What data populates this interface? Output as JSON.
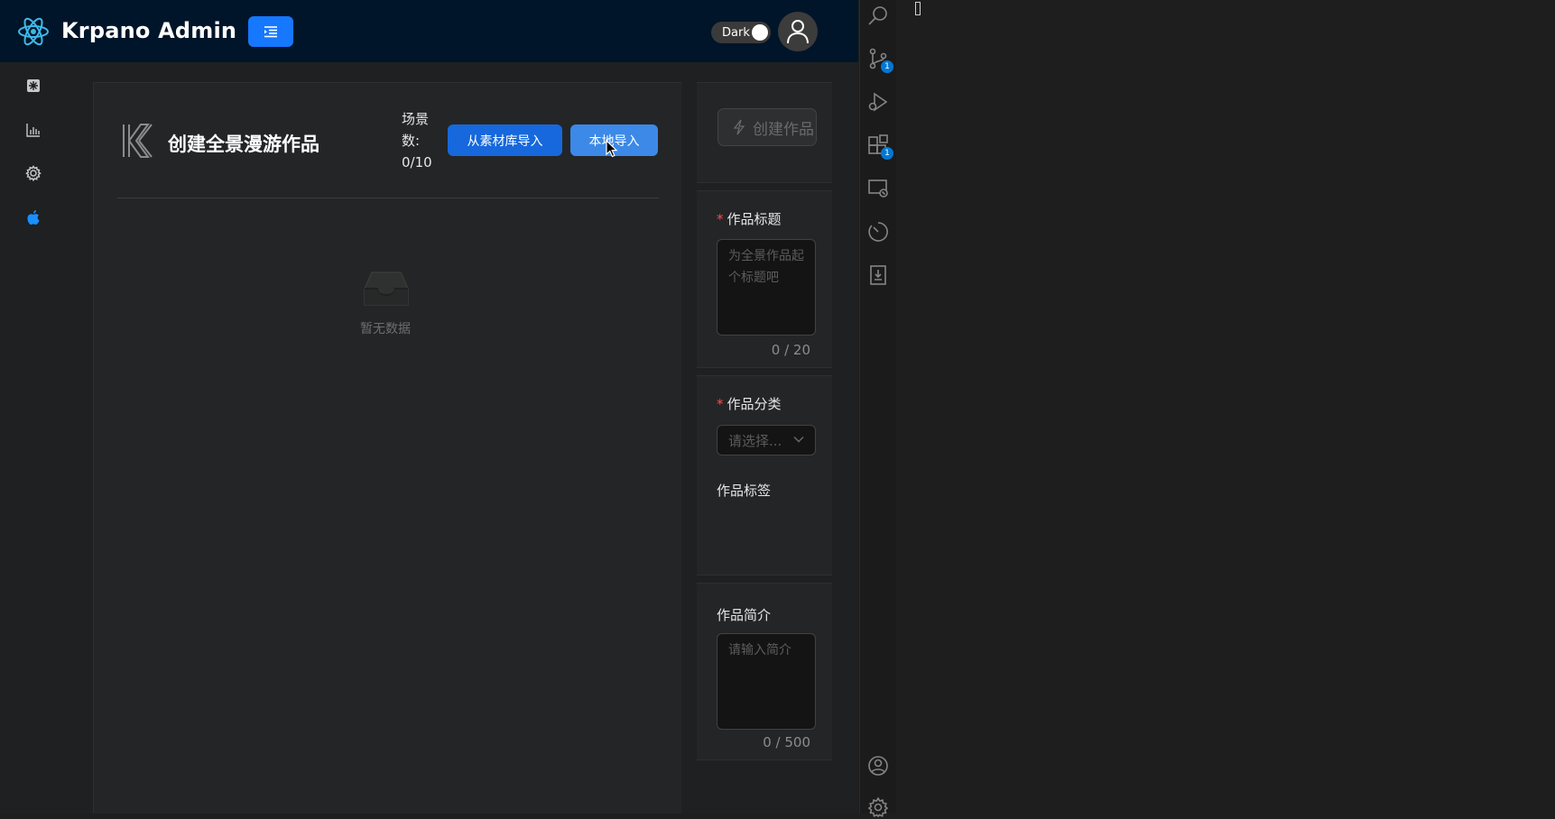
{
  "header": {
    "app_title": "Krpano Admin",
    "theme_switch_label": "Dark",
    "theme_switch_on": true
  },
  "sidebar": {
    "items": [
      {
        "icon": "dashboard-icon"
      },
      {
        "icon": "bar-chart-icon"
      },
      {
        "icon": "gear-icon"
      },
      {
        "icon": "apple-icon",
        "active": true
      }
    ]
  },
  "main": {
    "title": "创建全景漫游作品",
    "scene_count_label": "场景数:",
    "scene_count_value": "0/10",
    "import_from_library_label": "从素材库导入",
    "import_local_label": "本地导入",
    "empty_text": "暂无数据"
  },
  "form": {
    "create_button_label": "创建作品",
    "title_label": "作品标题",
    "title_placeholder": "为全景作品起个标题吧",
    "title_count": "0 / 20",
    "category_label": "作品分类",
    "category_placeholder": "请选择...",
    "tags_label": "作品标签",
    "intro_label": "作品简介",
    "intro_placeholder": "请输入简介",
    "intro_count": "0 / 500"
  },
  "activity_bar": {
    "items": [
      {
        "icon": "search-icon"
      },
      {
        "icon": "source-control-icon",
        "badge": "1"
      },
      {
        "icon": "run-debug-icon"
      },
      {
        "icon": "extensions-icon",
        "badge": "1"
      },
      {
        "icon": "remote-explorer-icon"
      },
      {
        "icon": "timeline-icon"
      },
      {
        "icon": "docker-icon"
      },
      {
        "icon": "account-icon"
      },
      {
        "icon": "manage-gear-icon",
        "badge": ""
      }
    ]
  },
  "colors": {
    "header_bg": "#001529",
    "primary": "#1668dc",
    "required": "#ff4d4f"
  }
}
